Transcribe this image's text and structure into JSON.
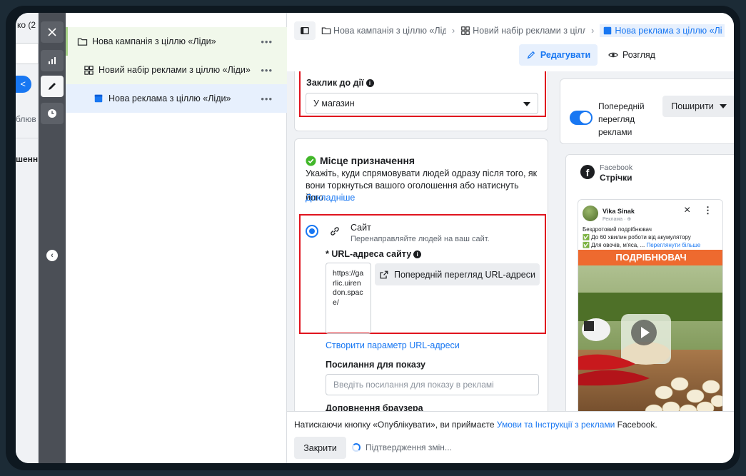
{
  "background_panel": {
    "truncated_title": "ко (2",
    "pill_text": "<",
    "label_1": "блюв",
    "label_2": "шенн"
  },
  "toolbar": {
    "close_icon": "close-icon",
    "tools": [
      "chart-icon",
      "pencil-icon",
      "clock-icon"
    ]
  },
  "tree": {
    "items": [
      {
        "label": "Нова кампанія з ціллю «Ліди»",
        "menu": "•••"
      },
      {
        "label": "Новий набір реклами з ціллю «Ліди»",
        "menu": "•••"
      },
      {
        "label": "Нова реклама з ціллю «Ліди»",
        "menu": "•••"
      }
    ]
  },
  "header": {
    "breadcrumbs": [
      "Нова кампанія з ціллю «Ліди»",
      "Новий набір реклами з ціллю «Ліди»",
      "Нова реклама з ціллю «Ліди»"
    ],
    "edit_label": "Редагувати",
    "view_label": "Розгляд"
  },
  "cta": {
    "label": "Заклик до дії",
    "value": "У магазин"
  },
  "destination": {
    "title": "Місце призначення",
    "description": "Укажіть, куди спрямовувати людей одразу після того, як вони торкнуться вашого оголошення або натиснуть його.",
    "learn_more": "Докладніше",
    "option_title": "Сайт",
    "option_desc": "Перенаправляйте людей на ваш сайт.",
    "url_label": "* URL-адреса сайту",
    "url_value": "https://garlic.uirendon.space/",
    "preview_url_button": "Попередній перегляд URL-адреси",
    "create_param_link": "Створити параметр URL-адреси",
    "display_link_label": "Посилання для показу",
    "display_link_placeholder": "Введіть посилання для показу в рекламі",
    "browser_addons_label": "Доповнення браузера"
  },
  "preview": {
    "toggle_label": "Попередній перегляд реклами",
    "share_button": "Поширити",
    "platform": "Facebook",
    "placement": "Стрічки",
    "post": {
      "author": "Vika Sinak",
      "sponsored": "Реклама · ⊕",
      "line1": "Бездротовий подрібнювач",
      "line2": "✅ До 60 хвилин роботи від акумулятору",
      "line3": "✅ Для овочів, м'яса, ...",
      "see_more": "Переглянути більше",
      "image_caption": "ПОДРІБНЮВАЧ"
    }
  },
  "footer": {
    "terms_prefix": "Натискаючи кнопку «Опублікувати», ви приймаєте ",
    "terms_link": "Умови та Інструкції з реклами",
    "terms_suffix": " Facebook.",
    "close_button": "Закрити",
    "status": "Підтвердження змін..."
  },
  "colors": {
    "accent": "#1877f2",
    "highlight_border": "#e0141e",
    "success": "#42b72a"
  }
}
